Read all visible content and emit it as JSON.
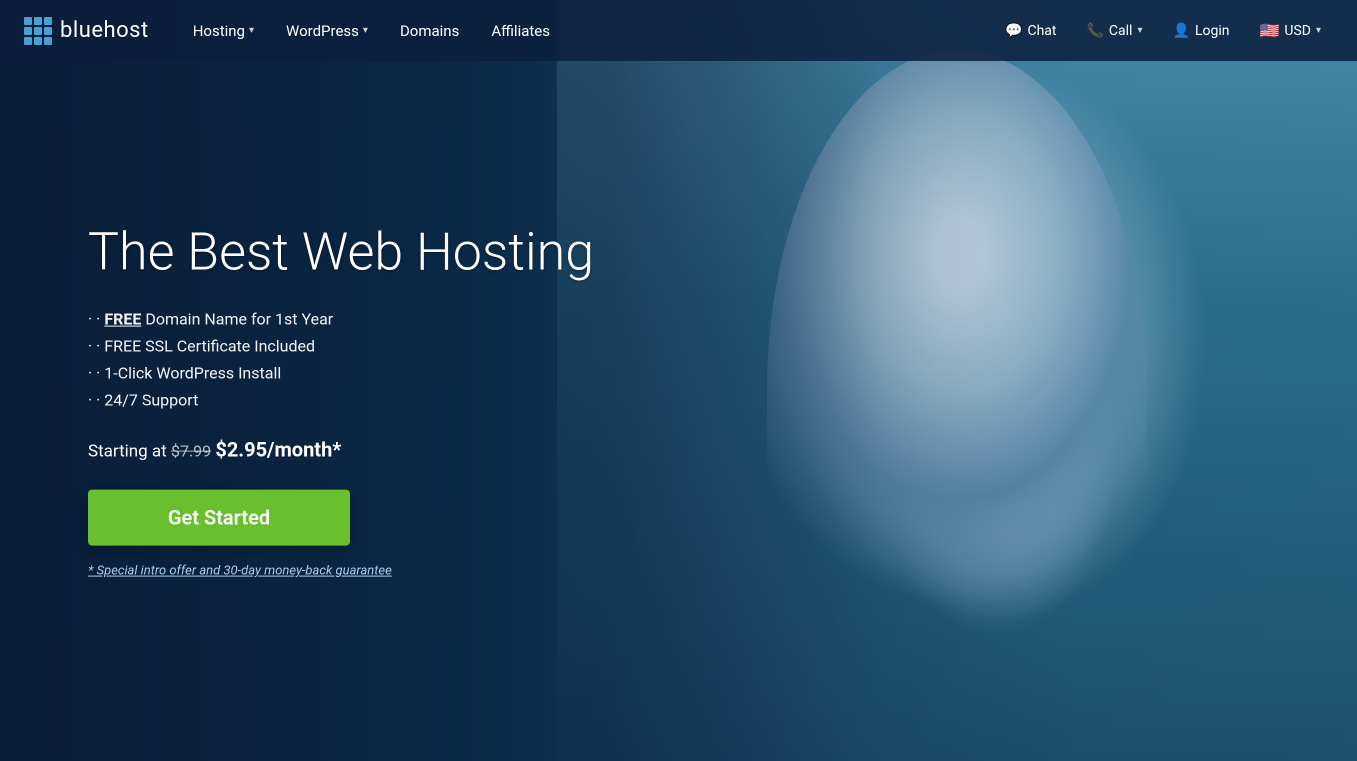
{
  "brand": {
    "name": "bluehost",
    "logo_alt": "Bluehost logo"
  },
  "nav": {
    "links": [
      {
        "id": "hosting",
        "label": "Hosting",
        "has_dropdown": true
      },
      {
        "id": "wordpress",
        "label": "WordPress",
        "has_dropdown": true
      },
      {
        "id": "domains",
        "label": "Domains",
        "has_dropdown": false
      },
      {
        "id": "affiliates",
        "label": "Affiliates",
        "has_dropdown": false
      }
    ],
    "right_items": [
      {
        "id": "chat",
        "label": "Chat",
        "icon": "💬"
      },
      {
        "id": "call",
        "label": "Call",
        "icon": "📞",
        "has_dropdown": true
      },
      {
        "id": "login",
        "label": "Login",
        "icon": "👤"
      },
      {
        "id": "currency",
        "label": "USD",
        "icon": "🇺🇸",
        "has_dropdown": true
      }
    ]
  },
  "hero": {
    "title": "The Best Web Hosting",
    "features": [
      {
        "id": "domain",
        "text": "FREE",
        "underline": true,
        "suffix": " Domain Name for 1st Year"
      },
      {
        "id": "ssl",
        "text": "FREE SSL Certificate Included",
        "underline": false
      },
      {
        "id": "wordpress",
        "text": "1-Click WordPress Install",
        "underline": false
      },
      {
        "id": "support",
        "text": "24/7 Support",
        "underline": false
      }
    ],
    "pricing": {
      "prefix": "Starting at ",
      "original_price": "$7.99",
      "current_price": "$2.95/month*"
    },
    "cta_button": "Get Started",
    "disclaimer": "* Special intro offer and 30-day money-back guarantee"
  }
}
